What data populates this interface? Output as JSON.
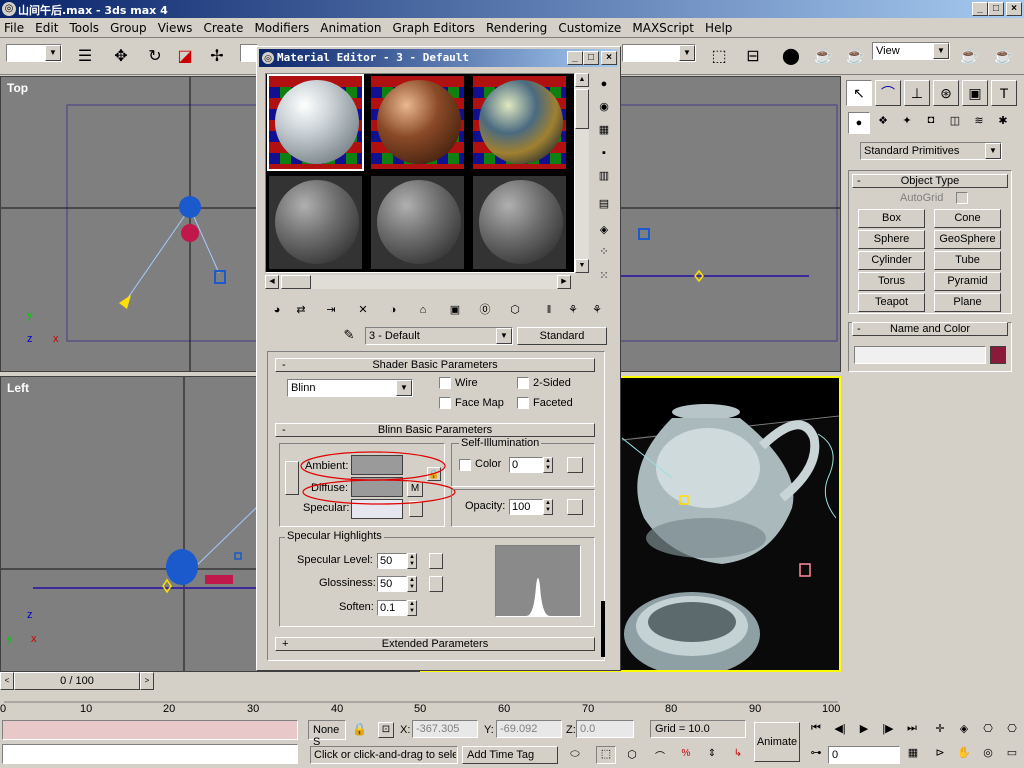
{
  "window": {
    "title": "山间午后.max - 3ds max 4",
    "min": "_",
    "max": "□",
    "close": "×"
  },
  "menu": [
    "File",
    "Edit",
    "Tools",
    "Group",
    "Views",
    "Create",
    "Modifiers",
    "Animation",
    "Graph Editors",
    "Rendering",
    "Customize",
    "MAXScript",
    "Help"
  ],
  "toolbar": {
    "view_dropdown": "View"
  },
  "viewports": {
    "top": "Top",
    "left": "Left",
    "axes": {
      "x": "x",
      "y": "y",
      "z": "z"
    }
  },
  "material_editor": {
    "title": "Material Editor - 3 - Default",
    "material_name": "3 - Default",
    "material_type": "Standard",
    "shader_rollout": "Shader Basic Parameters",
    "shader": "Blinn",
    "wire": "Wire",
    "two_sided": "2-Sided",
    "face_map": "Face Map",
    "faceted": "Faceted",
    "blinn_rollout": "Blinn Basic Parameters",
    "self_illum": "Self-Illumination",
    "color": "Color",
    "color_value": "0",
    "ambient": "Ambient:",
    "diffuse": "Diffuse:",
    "specular": "Specular:",
    "m": "M",
    "opacity": "Opacity:",
    "opacity_value": "100",
    "spec_highlights": "Specular Highlights",
    "spec_level": "Specular Level:",
    "spec_level_value": "50",
    "glossiness": "Glossiness:",
    "glossiness_value": "50",
    "soften": "Soften:",
    "soften_value": "0.1",
    "extended": "Extended Parameters",
    "collapse": "-",
    "expand": "+",
    "colors": {
      "ambient": "#9a9a9a",
      "diffuse": "#9a9a9a",
      "specular": "#e6e6ee",
      "highlight_circle": "#e00000"
    }
  },
  "command_panel": {
    "category": "Standard Primitives",
    "object_type": "Object Type",
    "autogrid": "AutoGrid",
    "buttons": [
      "Box",
      "Cone",
      "Sphere",
      "GeoSphere",
      "Cylinder",
      "Tube",
      "Torus",
      "Pyramid",
      "Teapot",
      "Plane"
    ],
    "name_color": "Name and Color",
    "object_color": "#8b1a3a"
  },
  "timeline": {
    "frame": "0 / 100",
    "ticks": [
      "0",
      "10",
      "20",
      "30",
      "40",
      "50",
      "60",
      "70",
      "80",
      "90",
      "100"
    ]
  },
  "status": {
    "selection": "None S",
    "x_label": "X:",
    "x": "-367.305",
    "y_label": "Y:",
    "y": "-69.092",
    "z_label": "Z:",
    "z": "0.0",
    "grid": "Grid = 10.0",
    "animate": "Animate",
    "prompt": "Click or click-and-drag to sele",
    "add_time_tag": "Add Time Tag",
    "frame_field": "0"
  }
}
